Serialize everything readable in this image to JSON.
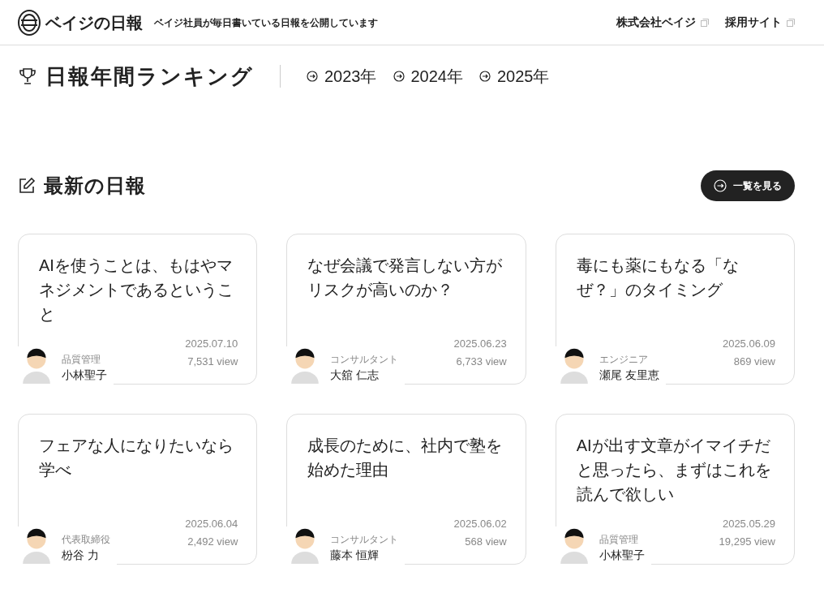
{
  "header": {
    "logo_text": "ベイジの日報",
    "tagline": "ベイジ社員が毎日書いている日報を公開しています",
    "links": [
      {
        "label": "株式会社ベイジ"
      },
      {
        "label": "採用サイト"
      }
    ]
  },
  "ranking": {
    "title": "日報年間ランキング",
    "years": [
      {
        "label": "2023年"
      },
      {
        "label": "2024年"
      },
      {
        "label": "2025年"
      }
    ]
  },
  "latest": {
    "title": "最新の日報",
    "more_button": "一覧を見る",
    "posts": [
      {
        "title": "AIを使うことは、もはやマネジメントであるということ",
        "date": "2025.07.10",
        "views": "7,531 view",
        "role": "品質管理",
        "author": "小林聖子"
      },
      {
        "title": "なぜ会議で発言しない方がリスクが高いのか？",
        "date": "2025.06.23",
        "views": "6,733 view",
        "role": "コンサルタント",
        "author": "大舘 仁志"
      },
      {
        "title": "毒にも薬にもなる「なぜ？」のタイミング",
        "date": "2025.06.09",
        "views": "869 view",
        "role": "エンジニア",
        "author": "瀬尾 友里恵"
      },
      {
        "title": "フェアな人になりたいなら学べ",
        "date": "2025.06.04",
        "views": "2,492 view",
        "role": "代表取締役",
        "author": "枌谷 力"
      },
      {
        "title": "成長のために、社内で塾を始めた理由",
        "date": "2025.06.02",
        "views": "568 view",
        "role": "コンサルタント",
        "author": "藤本 恒輝"
      },
      {
        "title": "AIが出す文章がイマイチだと思ったら、まずはこれを読んで欲しい",
        "date": "2025.05.29",
        "views": "19,295 view",
        "role": "品質管理",
        "author": "小林聖子"
      }
    ]
  }
}
